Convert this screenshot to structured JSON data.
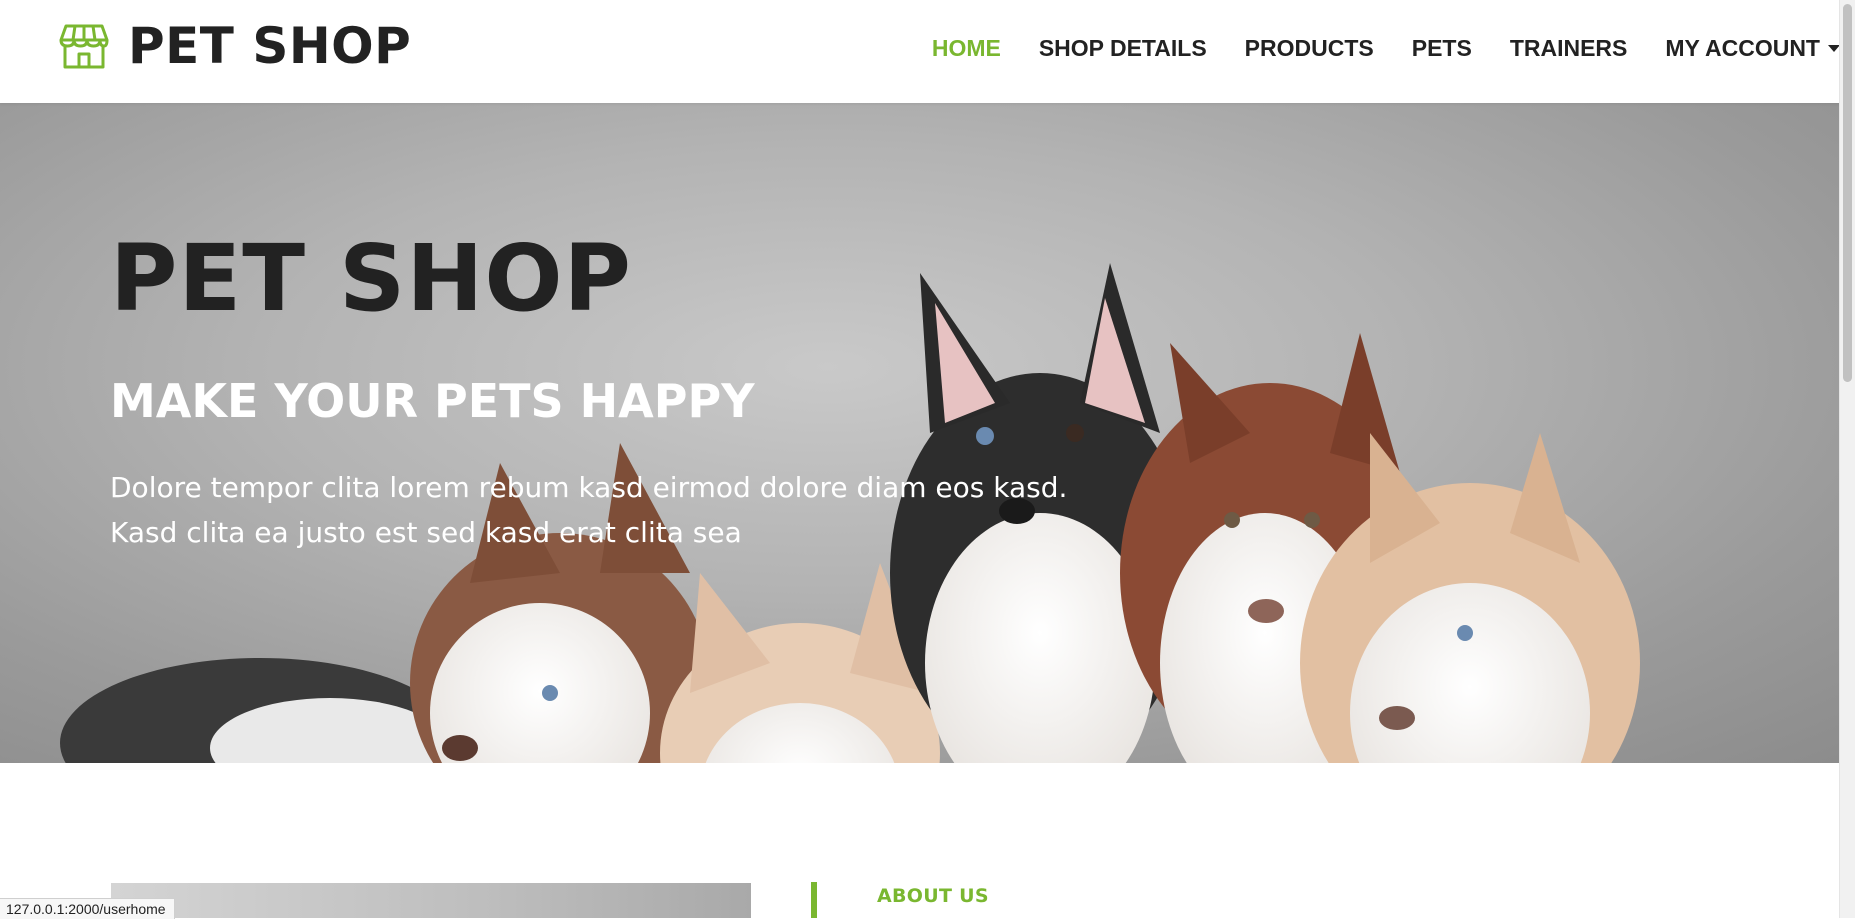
{
  "brand": {
    "name": "PET SHOP",
    "icon": "shop-icon",
    "accent": "#7AB730"
  },
  "nav": {
    "items": [
      {
        "label": "HOME",
        "active": true
      },
      {
        "label": "SHOP DETAILS"
      },
      {
        "label": "PRODUCTS"
      },
      {
        "label": "PETS"
      },
      {
        "label": "TRAINERS"
      },
      {
        "label": "MY ACCOUNT",
        "dropdown": true
      }
    ]
  },
  "hero": {
    "title": "PET SHOP",
    "subtitle": "MAKE YOUR PETS HAPPY",
    "text": "Dolore tempor clita lorem rebum kasd eirmod dolore diam eos kasd. Kasd clita ea justo est sed kasd erat clita sea"
  },
  "about": {
    "label": "ABOUT US"
  },
  "status_url": "127.0.0.1:2000/userhome"
}
